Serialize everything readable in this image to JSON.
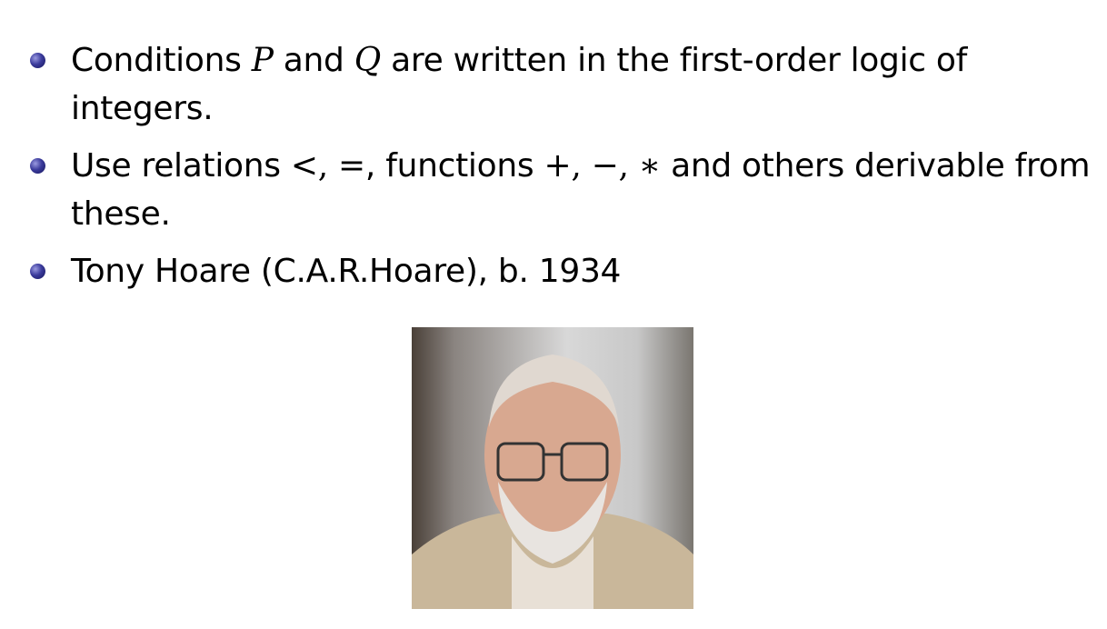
{
  "bullets": [
    {
      "a": "Conditions ",
      "m1": "P",
      "b": " and ",
      "m2": "Q",
      "c": " are written in the first-order logic of integers."
    },
    {
      "a": "Use relations ",
      "m1": "<, =",
      "b": ", functions ",
      "m2": "+, −, ∗",
      "c": " and others derivable from these."
    },
    {
      "a": "Tony Hoare (C.A.R.Hoare), b. 1934"
    }
  ],
  "photo": {
    "subject": "Tony Hoare portrait"
  }
}
